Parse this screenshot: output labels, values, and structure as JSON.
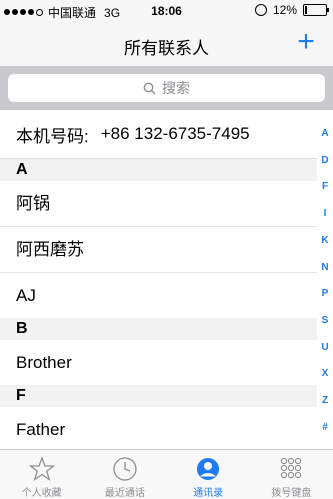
{
  "status_bar": {
    "carrier": "中国联通",
    "network": "3G",
    "time": "18:06",
    "battery": "12%",
    "battery_level": 0.12,
    "signal_bars": 4
  },
  "nav": {
    "title": "所有联系人",
    "add_label": "+"
  },
  "search": {
    "placeholder": "搜索"
  },
  "my_card": {
    "label": "本机号码:",
    "number": "+86 132-6735-7495"
  },
  "sections": [
    {
      "header": "A",
      "items": [
        "阿锅",
        "阿西磨苏",
        "AJ"
      ]
    },
    {
      "header": "B",
      "items": [
        "Brother"
      ]
    },
    {
      "header": "F",
      "items": [
        "Father"
      ]
    }
  ],
  "index_letters": [
    "A",
    "D",
    "F",
    "I",
    "K",
    "N",
    "P",
    "S",
    "U",
    "X",
    "Z",
    "#"
  ],
  "tabs": [
    {
      "label": "个人收藏",
      "icon": "star-icon",
      "active": false
    },
    {
      "label": "最近通话",
      "icon": "clock-icon",
      "active": false
    },
    {
      "label": "通讯录",
      "icon": "contacts-icon",
      "active": true
    },
    {
      "label": "拨号键盘",
      "icon": "keypad-icon",
      "active": false
    }
  ],
  "colors": {
    "accent": "#1c7cf0",
    "bar_background": "#f7f7f7",
    "search_background": "#c9c9ce",
    "section_header": "#f2f2f2"
  }
}
